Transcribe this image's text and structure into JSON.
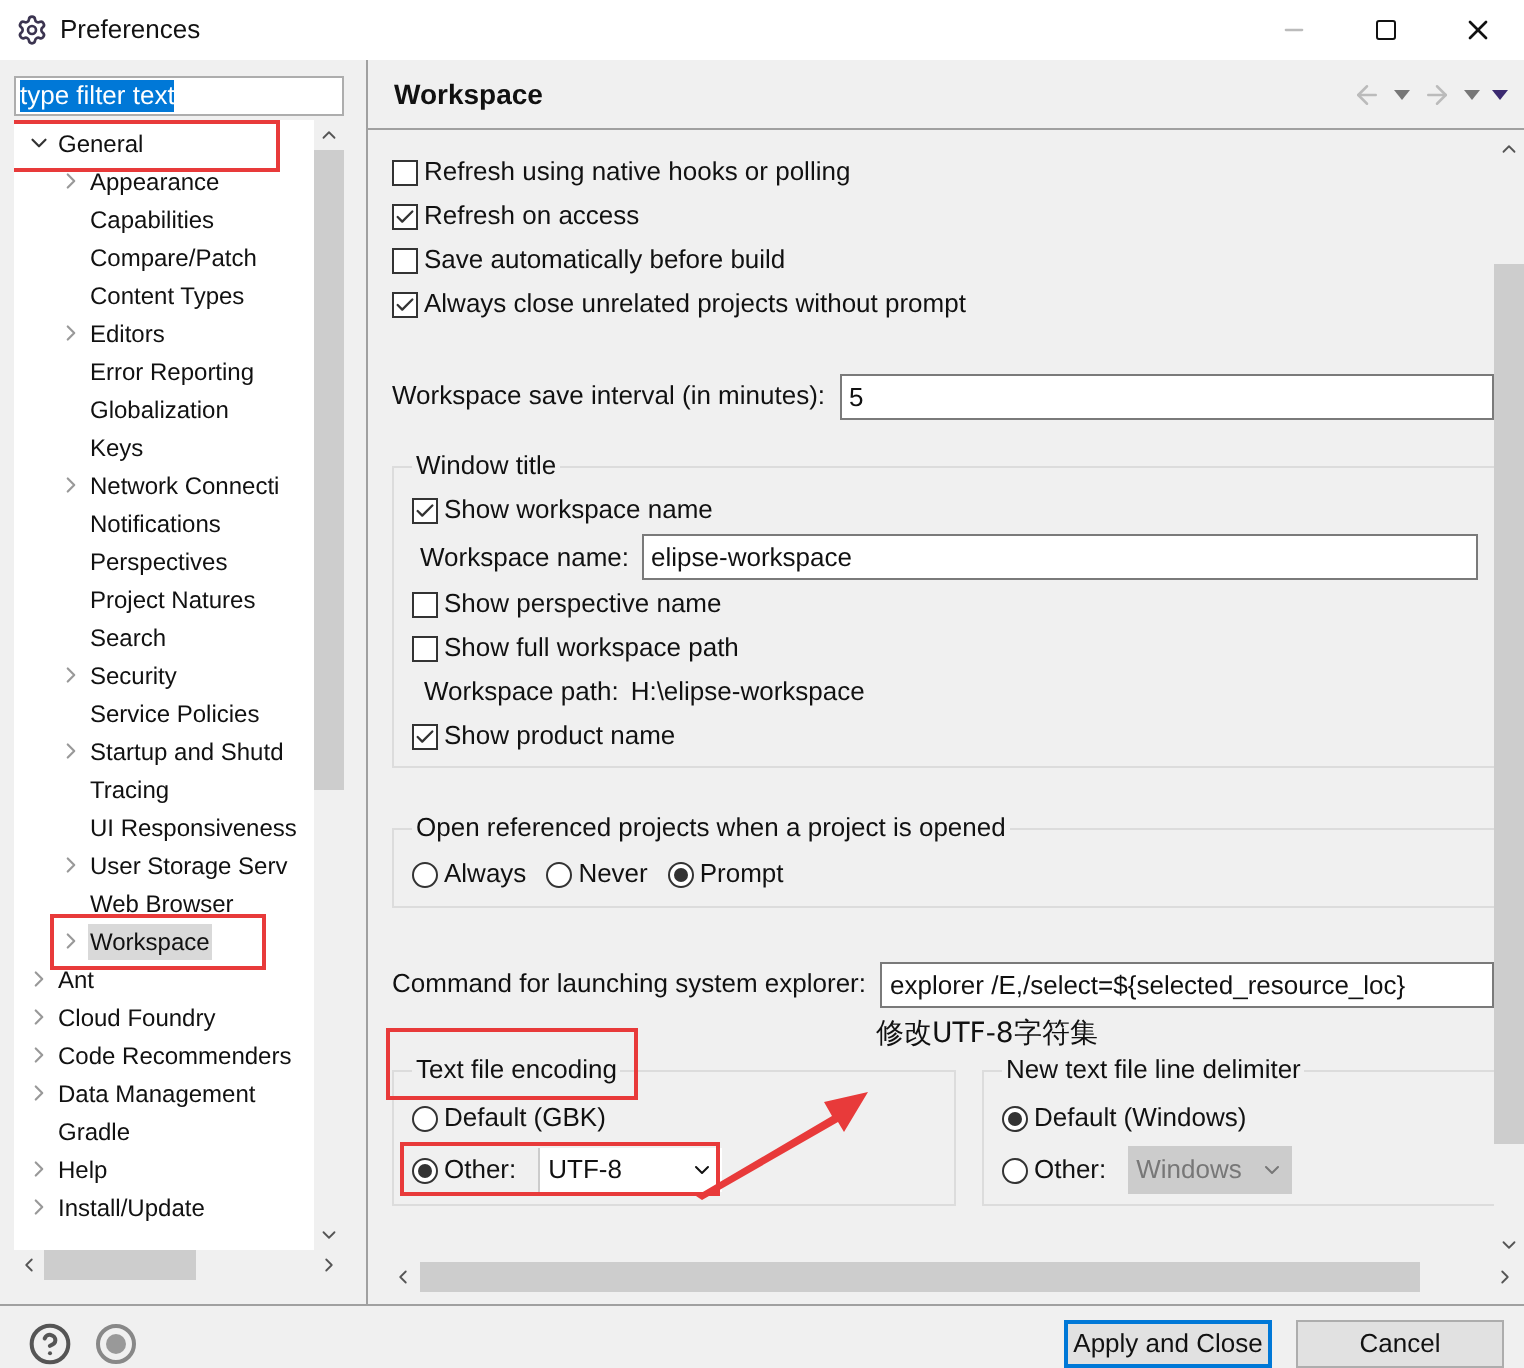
{
  "window": {
    "title": "Preferences"
  },
  "filter": {
    "value": "type filter text"
  },
  "tree": [
    {
      "label": "General",
      "kind": "branch",
      "expanded": true,
      "selected": false,
      "children": [
        {
          "label": "Appearance",
          "kind": "branch",
          "expanded": false,
          "selected": false
        },
        {
          "label": "Capabilities",
          "kind": "leaf",
          "selected": false
        },
        {
          "label": "Compare/Patch",
          "kind": "leaf",
          "selected": false
        },
        {
          "label": "Content Types",
          "kind": "leaf",
          "selected": false
        },
        {
          "label": "Editors",
          "kind": "branch",
          "expanded": false,
          "selected": false
        },
        {
          "label": "Error Reporting",
          "kind": "leaf",
          "selected": false
        },
        {
          "label": "Globalization",
          "kind": "leaf",
          "selected": false
        },
        {
          "label": "Keys",
          "kind": "leaf",
          "selected": false
        },
        {
          "label": "Network Connecti",
          "kind": "branch",
          "expanded": false,
          "selected": false
        },
        {
          "label": "Notifications",
          "kind": "leaf",
          "selected": false
        },
        {
          "label": "Perspectives",
          "kind": "leaf",
          "selected": false
        },
        {
          "label": "Project Natures",
          "kind": "leaf",
          "selected": false
        },
        {
          "label": "Search",
          "kind": "leaf",
          "selected": false
        },
        {
          "label": "Security",
          "kind": "branch",
          "expanded": false,
          "selected": false
        },
        {
          "label": "Service Policies",
          "kind": "leaf",
          "selected": false
        },
        {
          "label": "Startup and Shutd",
          "kind": "branch",
          "expanded": false,
          "selected": false
        },
        {
          "label": "Tracing",
          "kind": "leaf",
          "selected": false
        },
        {
          "label": "UI Responsiveness",
          "kind": "leaf",
          "selected": false
        },
        {
          "label": "User Storage Serv",
          "kind": "branch",
          "expanded": false,
          "selected": false
        },
        {
          "label": "Web Browser",
          "kind": "leaf",
          "selected": false
        },
        {
          "label": "Workspace",
          "kind": "branch",
          "expanded": false,
          "selected": true
        }
      ]
    },
    {
      "label": "Ant",
      "kind": "branch",
      "expanded": false,
      "selected": false
    },
    {
      "label": "Cloud Foundry",
      "kind": "branch",
      "expanded": false,
      "selected": false
    },
    {
      "label": "Code Recommenders",
      "kind": "branch",
      "expanded": false,
      "selected": false
    },
    {
      "label": "Data Management",
      "kind": "branch",
      "expanded": false,
      "selected": false
    },
    {
      "label": "Gradle",
      "kind": "leaf",
      "selected": false
    },
    {
      "label": "Help",
      "kind": "branch",
      "expanded": false,
      "selected": false
    },
    {
      "label": "Install/Update",
      "kind": "branch",
      "expanded": false,
      "selected": false
    }
  ],
  "page": {
    "title": "Workspace",
    "options": [
      {
        "label": "Refresh using native hooks or polling",
        "checked": false
      },
      {
        "label": "Refresh on access",
        "checked": true
      },
      {
        "label": "Save automatically before build",
        "checked": false
      },
      {
        "label": "Always close unrelated projects without prompt",
        "checked": true
      }
    ],
    "save_interval": {
      "label": "Workspace save interval (in minutes):",
      "value": "5"
    },
    "window_title": {
      "title": "Window title",
      "rows": [
        {
          "kind": "checkbox",
          "label": "Show workspace name",
          "checked": true
        },
        {
          "kind": "field",
          "label": "Workspace name:",
          "value": "elipse-workspace"
        },
        {
          "kind": "checkbox",
          "label": "Show perspective name",
          "checked": false
        },
        {
          "kind": "checkbox",
          "label": "Show full workspace path",
          "checked": false
        },
        {
          "kind": "info",
          "label": "Workspace path:",
          "value": "H:\\elipse-workspace"
        },
        {
          "kind": "checkbox",
          "label": "Show product name",
          "checked": true
        }
      ]
    },
    "open_referenced": {
      "title": "Open referenced projects when a project is opened",
      "choices": [
        {
          "label": "Always",
          "selected": false
        },
        {
          "label": "Never",
          "selected": false
        },
        {
          "label": "Prompt",
          "selected": true
        }
      ]
    },
    "explorer_command": {
      "label": "Command for launching system explorer:",
      "value": "explorer /E,/select=${selected_resource_loc}"
    },
    "encoding": {
      "title": "Text file encoding",
      "choices": [
        {
          "label": "Default (GBK)",
          "selected": false
        },
        {
          "label": "Other:",
          "selected": true
        }
      ],
      "other_value": "UTF-8"
    },
    "line_delimiter": {
      "title": "New text file line delimiter",
      "choices": [
        {
          "label": "Default (Windows)",
          "selected": true
        },
        {
          "label": "Other:",
          "selected": false
        }
      ],
      "other_value": "Windows"
    }
  },
  "annotation": {
    "note": "修改UTF-8字符集"
  },
  "buttons": [
    {
      "label": "Apply and Close",
      "default": true
    },
    {
      "label": "Cancel",
      "default": false
    }
  ]
}
